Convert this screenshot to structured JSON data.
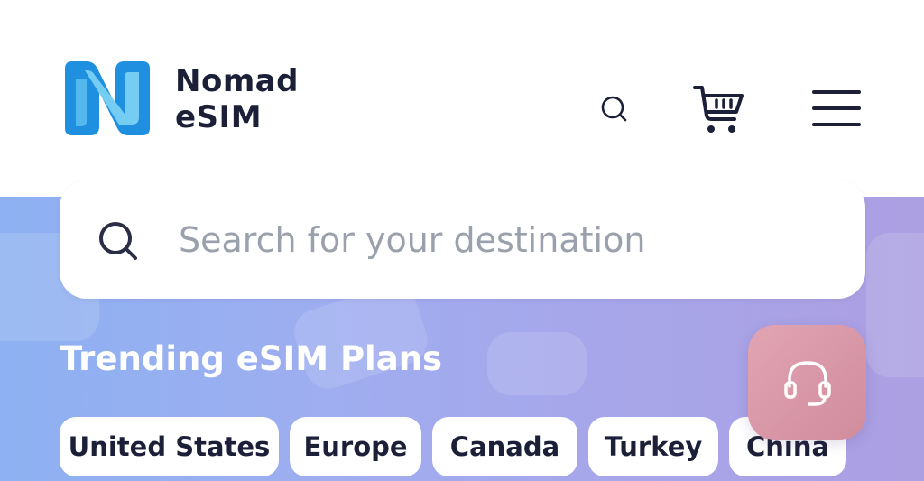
{
  "brand": {
    "name_line1": "Nomad",
    "name_line2": "eSIM",
    "logo_icon": "nomad-logo-icon",
    "colors": {
      "logo_dark": "#1f8fe0",
      "logo_light": "#62c6f2",
      "text": "#1c1f38"
    }
  },
  "header": {
    "icons": [
      "search-icon",
      "cart-icon",
      "menu-icon"
    ]
  },
  "search": {
    "placeholder": "Search for your destination",
    "icon": "search-icon"
  },
  "trending": {
    "title": "Trending eSIM Plans",
    "chips": [
      "United States",
      "Europe",
      "Canada",
      "Turkey",
      "China"
    ]
  },
  "support": {
    "icon": "headset-icon"
  },
  "colors": {
    "hero_gradient_start": "#8db1f2",
    "hero_gradient_end": "#ac9fe2",
    "support_button": "#d996a6",
    "placeholder_text": "#9aa0ac"
  }
}
